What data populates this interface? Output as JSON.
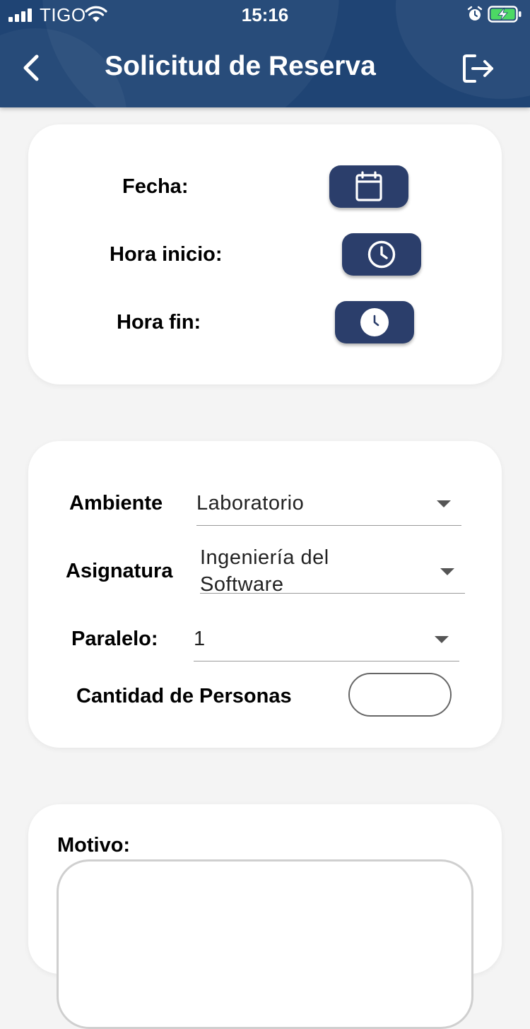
{
  "status_bar": {
    "carrier": "TIGO",
    "time": "15:16"
  },
  "header": {
    "title": "Solicitud de Reserva"
  },
  "schedule": {
    "date_label": "Fecha:",
    "start_label": "Hora inicio:",
    "end_label": "Hora fin:"
  },
  "details": {
    "room_label": "Ambiente",
    "room_value": "Laboratorio",
    "subject_label": "Asignatura",
    "subject_value_line1": "Ingeniería del",
    "subject_value_line2": "Software",
    "section_label": "Paralelo:",
    "section_value": "1",
    "people_label": "Cantidad de Personas",
    "people_value": ""
  },
  "reason": {
    "label": "Motivo:",
    "value": ""
  },
  "colors": {
    "header_bg": "#1f4474",
    "button_bg": "#2b3e6b",
    "battery_charging": "#4cd964"
  }
}
